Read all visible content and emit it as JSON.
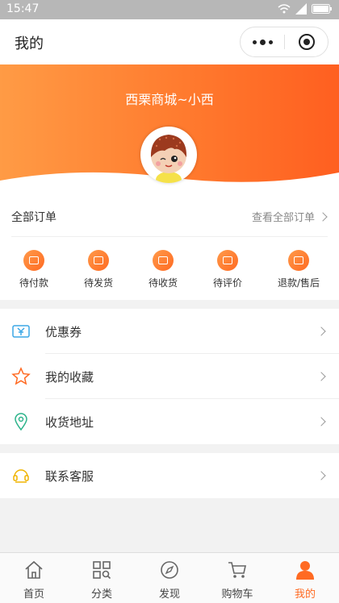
{
  "status_bar": {
    "time": "15:47"
  },
  "nav": {
    "title": "我的"
  },
  "header": {
    "shop_name": "西栗商城~小西"
  },
  "orders": {
    "title": "全部订单",
    "view_all": "查看全部订单",
    "items": [
      {
        "label": "待付款",
        "icon": "wallet-icon"
      },
      {
        "label": "待发货",
        "icon": "package-icon"
      },
      {
        "label": "待收货",
        "icon": "truck-icon"
      },
      {
        "label": "待评价",
        "icon": "comment-icon"
      },
      {
        "label": "退款/售后",
        "icon": "refund-icon"
      }
    ]
  },
  "menu": [
    {
      "label": "优惠券",
      "icon": "coupon-icon"
    },
    {
      "label": "我的收藏",
      "icon": "star-icon"
    },
    {
      "label": "收货地址",
      "icon": "location-icon"
    }
  ],
  "service": {
    "label": "联系客服",
    "icon": "customer-service-icon"
  },
  "tabs": [
    {
      "label": "首页",
      "icon": "home-icon"
    },
    {
      "label": "分类",
      "icon": "category-icon"
    },
    {
      "label": "发现",
      "icon": "compass-icon"
    },
    {
      "label": "购物车",
      "icon": "cart-icon"
    },
    {
      "label": "我的",
      "icon": "user-icon",
      "active": true
    }
  ],
  "colors": {
    "accent": "#ff6a22",
    "header_start": "#ff9b45",
    "header_end": "#ff5f20"
  }
}
